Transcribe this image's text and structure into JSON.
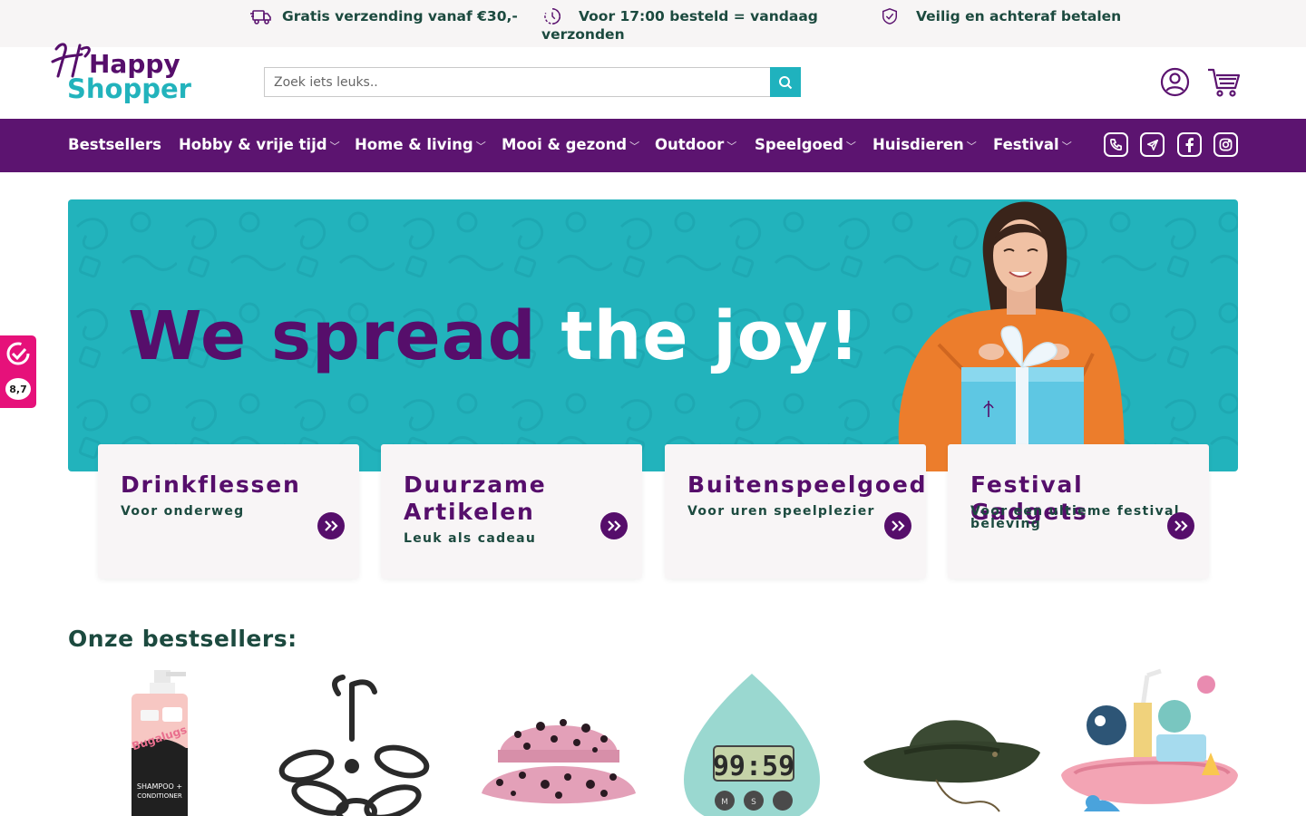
{
  "usp": {
    "shipping": "Gratis verzending vanaf €30,-",
    "sameday_line1": "Voor 17:00 besteld = vandaag",
    "sameday_line2": "verzonden",
    "payment": "Veilig en achteraf betalen"
  },
  "logo": {
    "line1": "Happy",
    "line2": "Shopper"
  },
  "search": {
    "placeholder": "Zoek iets leuks.."
  },
  "nav": {
    "items": [
      {
        "label": "Bestsellers"
      },
      {
        "label": "Hobby & vrije tijd"
      },
      {
        "label": "Home & living"
      },
      {
        "label": "Mooi & gezond"
      },
      {
        "label": "Outdoor"
      },
      {
        "label": "Speelgoed"
      },
      {
        "label": "Huisdieren"
      },
      {
        "label": "Festival"
      }
    ],
    "social_icons": [
      "phone-icon",
      "send-icon",
      "facebook-icon",
      "instagram-icon"
    ]
  },
  "hero": {
    "title_part1": "We spread",
    "title_part2": "the joy!"
  },
  "categories": [
    {
      "title": "Drinkflessen",
      "subtitle": "Voor onderweg"
    },
    {
      "title_line1": "Duurzame",
      "title_line2": "Artikelen",
      "subtitle": "Leuk als cadeau"
    },
    {
      "title": "Buitenspeelgoed",
      "subtitle": "Voor uren speelplezier"
    },
    {
      "title": "Festival Gadgets",
      "subtitle_line1": "Voor een ultieme festival",
      "subtitle_line2": "beleving"
    }
  ],
  "bestsellers": {
    "title": "Onze bestsellers:",
    "products": [
      "shampoo",
      "drying-rack",
      "leopard-bucket-hat",
      "kitchen-timer",
      "safari-hat",
      "bath-toy"
    ],
    "timer_display": "99:59"
  },
  "review": {
    "score": "8,7"
  },
  "colors": {
    "purple": "#5c1470",
    "teal": "#22b3bc",
    "dark_green": "#1c4a3f",
    "pink": "#e6117a"
  }
}
